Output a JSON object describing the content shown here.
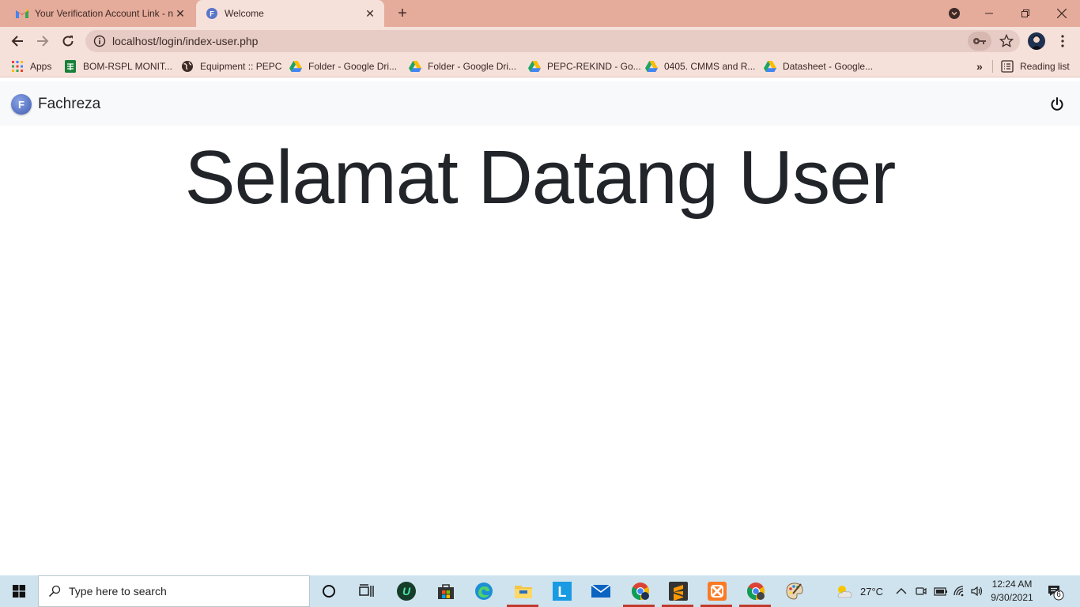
{
  "tabs": [
    {
      "title": "Your Verification Account Link - n",
      "favicon": "gmail-icon"
    },
    {
      "title": "Welcome",
      "favicon": "fachreza-favicon"
    }
  ],
  "toolbar": {
    "url": "localhost/login/index-user.php"
  },
  "bookmarks": {
    "apps_label": "Apps",
    "items": [
      {
        "label": "BOM-RSPL MONIT..."
      },
      {
        "label": "Equipment :: PEPC"
      },
      {
        "label": "Folder - Google Dri..."
      },
      {
        "label": "Folder - Google Dri..."
      },
      {
        "label": "PEPC-REKIND - Go..."
      },
      {
        "label": "0405. CMMS and R..."
      },
      {
        "label": "Datasheet - Google..."
      }
    ],
    "overflow_label": "»",
    "reading_list_label": "Reading list"
  },
  "page": {
    "brand_initial": "F",
    "brand_name": "Fachreza",
    "heading": "Selamat Datang User"
  },
  "taskbar": {
    "search_placeholder": "Type here to search",
    "weather_temp": "27°C",
    "time": "12:24 AM",
    "date": "9/30/2021",
    "notification_count": "6"
  },
  "colors": {
    "tabstrip": "#e5ab9b",
    "toolbar": "#f5e0da",
    "page_nav": "#f8f9fa",
    "heading_text": "#212529",
    "taskbar": "#cfe3ee"
  }
}
